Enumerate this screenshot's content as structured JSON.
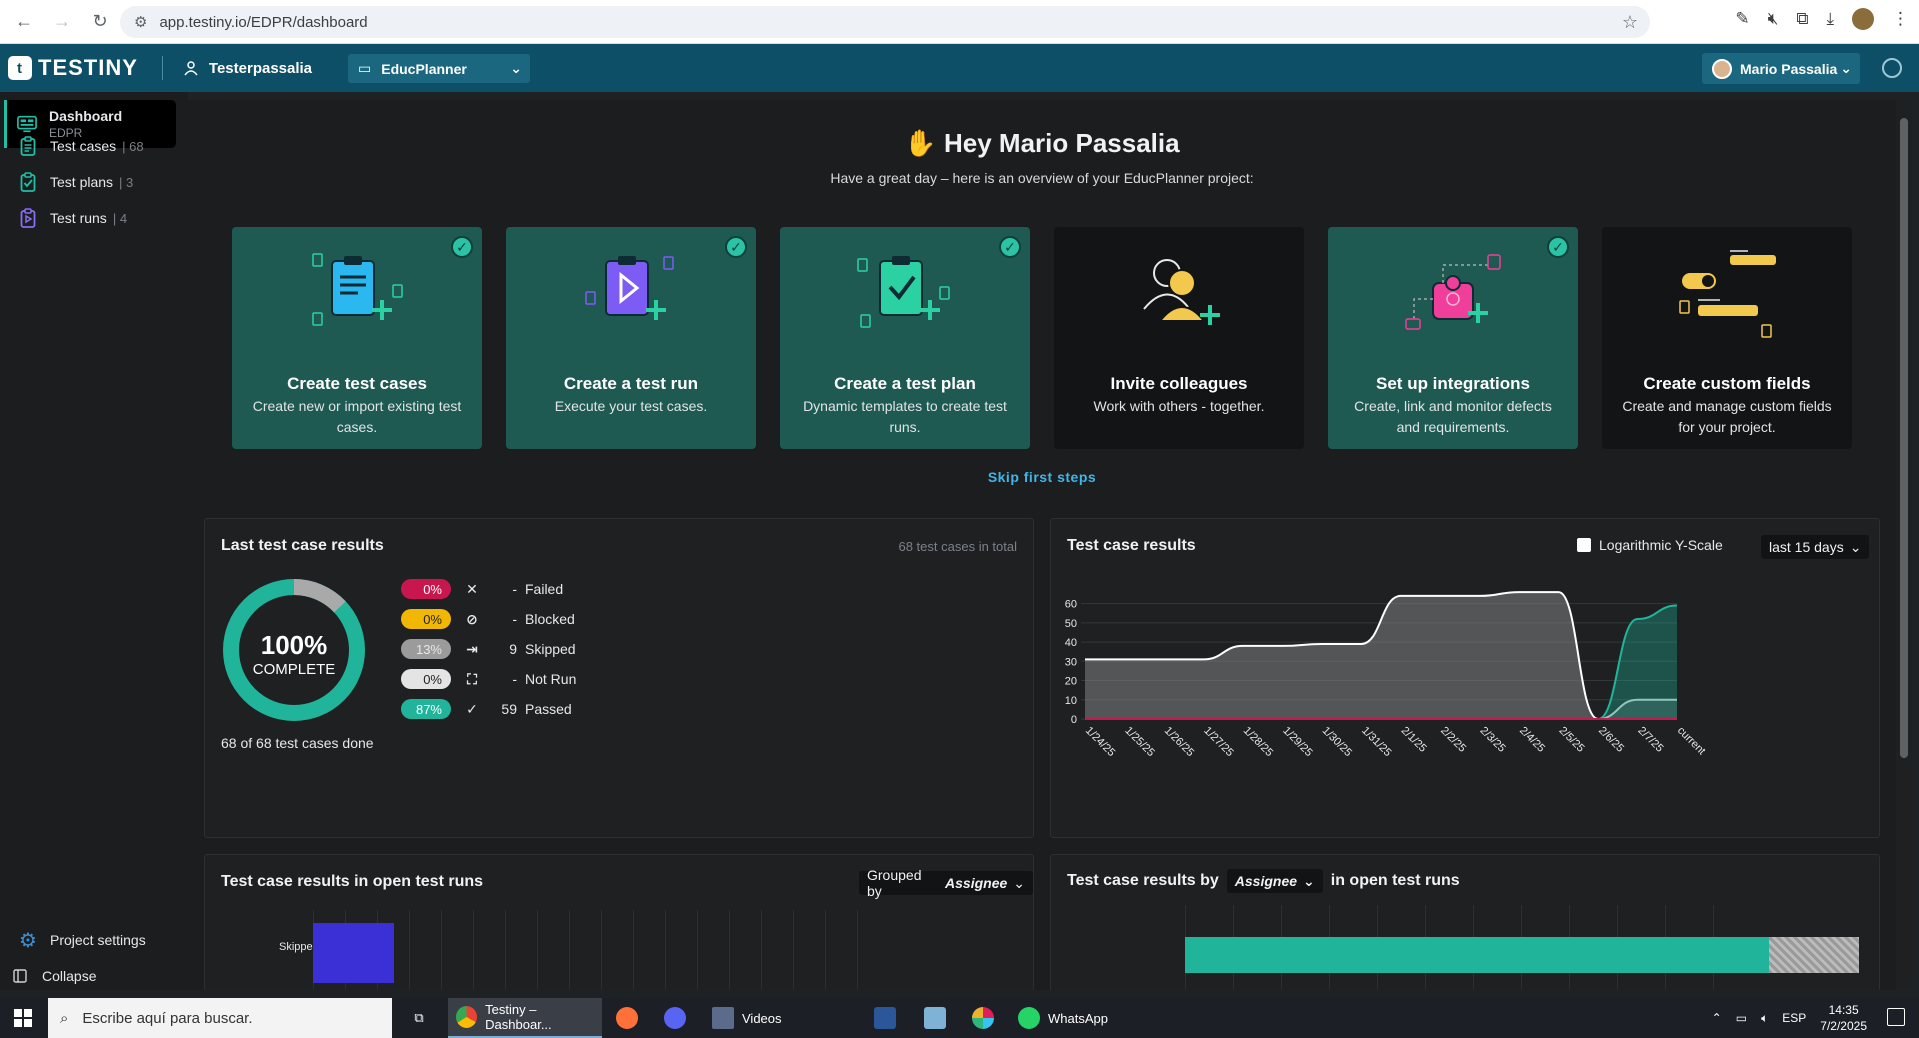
{
  "browser": {
    "url": "app.testiny.io/EDPR/dashboard"
  },
  "header": {
    "logo": "TESTINY",
    "workspace": "Testerpassalia",
    "project": "EducPlanner",
    "user": "Mario Passalia"
  },
  "sidebar": {
    "items": [
      {
        "label": "Dashboard",
        "sub": "EDPR"
      },
      {
        "label": "Test cases",
        "count": "68"
      },
      {
        "label": "Test plans",
        "count": "3"
      },
      {
        "label": "Test runs",
        "count": "4"
      }
    ],
    "settings_label": "Project settings",
    "collapse_label": "Collapse"
  },
  "main": {
    "greeting": "Hey Mario Passalia",
    "subtitle": "Have a great day – here is an overview of your EducPlanner project:",
    "steps": [
      {
        "title": "Create test cases",
        "desc": "Create new or import existing test cases.",
        "done": true
      },
      {
        "title": "Create a test run",
        "desc": "Execute your test cases.",
        "done": true
      },
      {
        "title": "Create a test plan",
        "desc": "Dynamic templates to create test runs.",
        "done": true
      },
      {
        "title": "Invite colleagues",
        "desc": "Work with others - together.",
        "done": false
      },
      {
        "title": "Set up integrations",
        "desc": "Create, link and monitor defects and requirements.",
        "done": true
      },
      {
        "title": "Create custom fields",
        "desc": "Create and manage custom fields for your project.",
        "done": false
      }
    ],
    "skip_label": "Skip first steps"
  },
  "last_results": {
    "title": "Last test case results",
    "total": "68 test cases in total",
    "complete_pct": "100%",
    "complete_label": "COMPLETE",
    "done_text": "68 of 68 test cases done",
    "legend": [
      {
        "pct": "0%",
        "count": "-",
        "label": "Failed",
        "color": "#c8174e",
        "text_color": "#ffffff"
      },
      {
        "pct": "0%",
        "count": "-",
        "label": "Blocked",
        "color": "#f2b705",
        "text_color": "#1e2022"
      },
      {
        "pct": "13%",
        "count": "9",
        "label": "Skipped",
        "color": "#9b9b9b",
        "text_color": "#e6e8ea"
      },
      {
        "pct": "0%",
        "count": "-",
        "label": "Not Run",
        "color": "#e4e4e4",
        "text_color": "#1e2022"
      },
      {
        "pct": "87%",
        "count": "59",
        "label": "Passed",
        "color": "#20b59a",
        "text_color": "#ffffff"
      }
    ]
  },
  "results_chart": {
    "title": "Test case results",
    "log_label": "Logarithmic Y-Scale",
    "range_label": "last 15 days"
  },
  "chart_data": {
    "type": "area",
    "x": [
      "1/24/25",
      "1/25/25",
      "1/26/25",
      "1/27/25",
      "1/28/25",
      "1/29/25",
      "1/30/25",
      "1/31/25",
      "2/1/25",
      "2/2/25",
      "2/3/25",
      "2/4/25",
      "2/5/25",
      "2/6/25",
      "2/7/25",
      "current"
    ],
    "ylim": [
      0,
      65
    ],
    "yticks": [
      0,
      10,
      20,
      30,
      40,
      50,
      60
    ],
    "series": [
      {
        "values": [
          31,
          31,
          31,
          31,
          38,
          38,
          39,
          39,
          64,
          64,
          64,
          66,
          66,
          0,
          0,
          0
        ],
        "color": "#ffffff"
      },
      {
        "values": [
          0,
          0,
          0,
          0,
          0,
          0,
          0,
          0,
          0,
          0,
          0,
          0,
          0,
          0,
          10,
          10
        ],
        "color": "#cfcfcf"
      },
      {
        "values": [
          0,
          0,
          0,
          0,
          0,
          0,
          0,
          0,
          0,
          0,
          0,
          0,
          0,
          0,
          52,
          59
        ],
        "color": "#20b59a"
      },
      {
        "values": [
          0,
          0,
          0,
          0,
          0,
          0,
          0,
          0,
          0,
          0,
          0,
          0,
          0,
          0,
          0,
          0
        ],
        "color": "#c8174e"
      }
    ]
  },
  "open_runs": {
    "title": "Test case results in open test runs",
    "grouped_prefix": "Grouped by",
    "grouped_value": "Assignee",
    "bar_label": "Skipped",
    "by_prefix": "Test case results by",
    "by_value": "Assignee",
    "by_suffix": "in open test runs"
  },
  "taskbar": {
    "search_placeholder": "Escribe aquí para buscar.",
    "chrome_label": "Testiny – Dashboar...",
    "videos_label": "Videos",
    "whatsapp_label": "WhatsApp",
    "lang": "ESP",
    "time": "14:35",
    "date": "7/2/2025"
  }
}
